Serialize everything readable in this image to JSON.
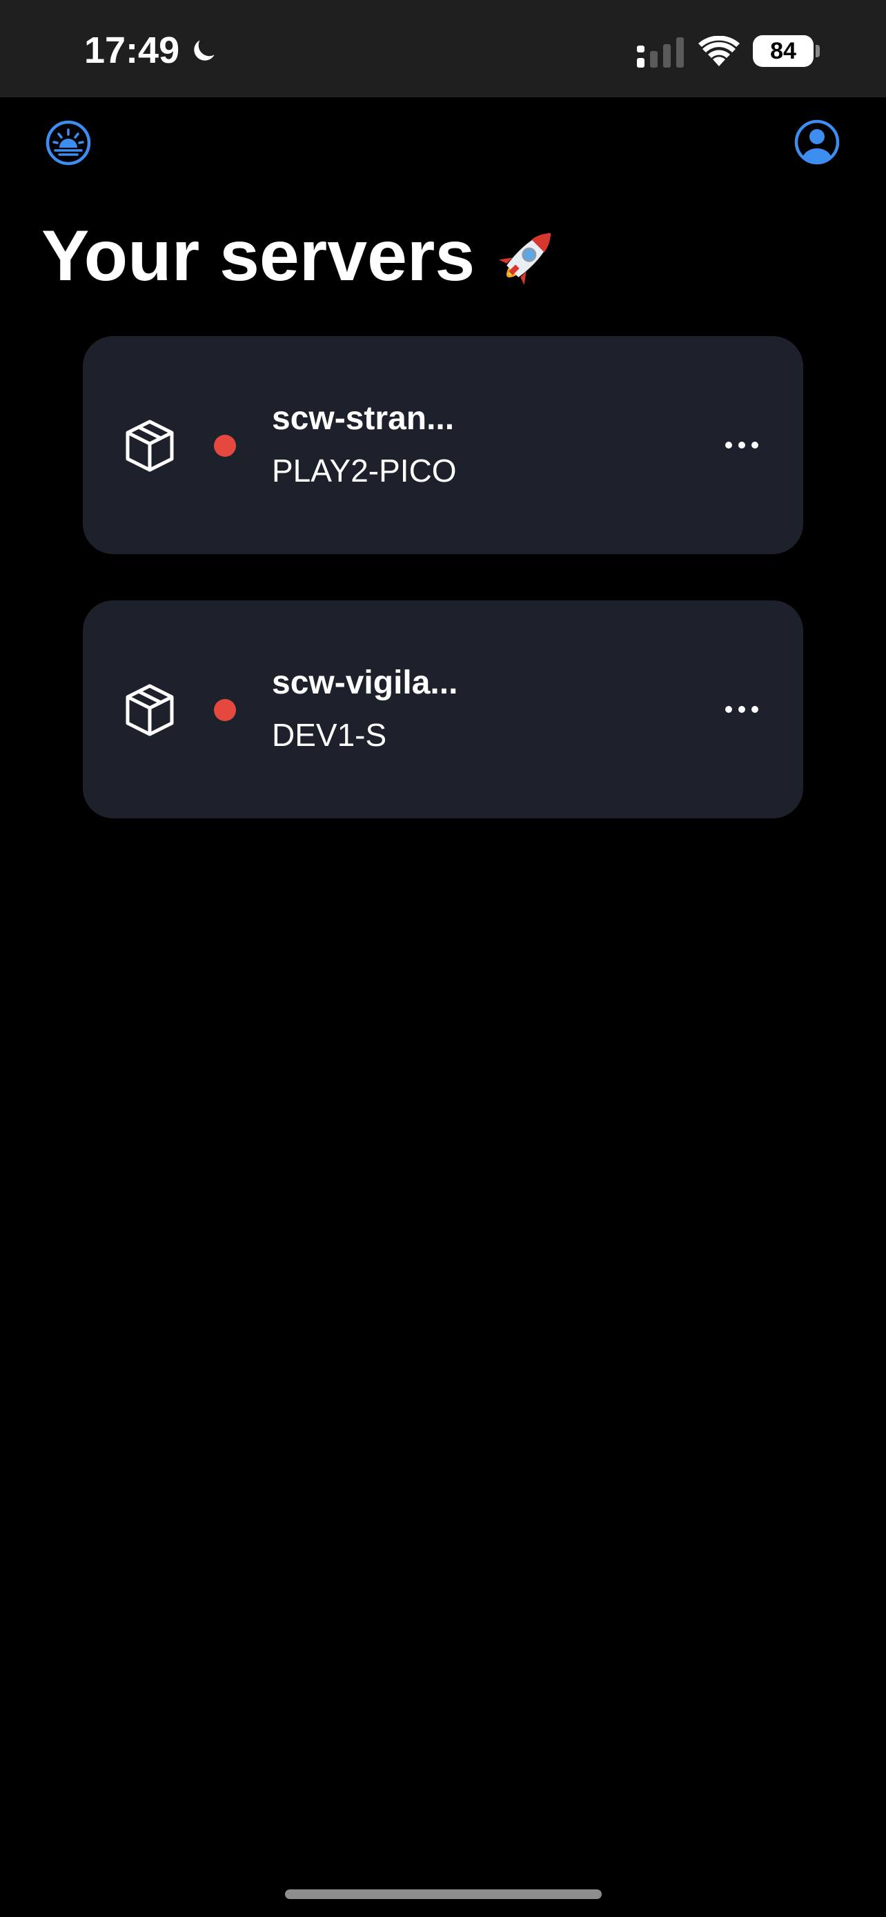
{
  "status_bar": {
    "time": "17:49",
    "battery": "84",
    "icons": [
      "moon-icon",
      "cellular-signal-icon",
      "wifi-icon",
      "battery-icon"
    ]
  },
  "header": {
    "left_icon": "sunrise-icon",
    "right_icon": "user-profile-icon",
    "accent_color": "#3d8ef0"
  },
  "page": {
    "title": "Your servers",
    "title_emoji": "rocket-icon"
  },
  "servers": [
    {
      "name": "scw-stran...",
      "type": "PLAY2-PICO",
      "icon": "cube-icon",
      "status_color": "#e5483f",
      "menu_icon": "more-horizontal-icon"
    },
    {
      "name": "scw-vigila...",
      "type": "DEV1-S",
      "icon": "cube-icon",
      "status_color": "#e5483f",
      "menu_icon": "more-horizontal-icon"
    }
  ],
  "colors": {
    "background": "#000000",
    "status_bar_background": "#1f1f1f",
    "card_background": "#1d212b",
    "text": "#ffffff"
  }
}
